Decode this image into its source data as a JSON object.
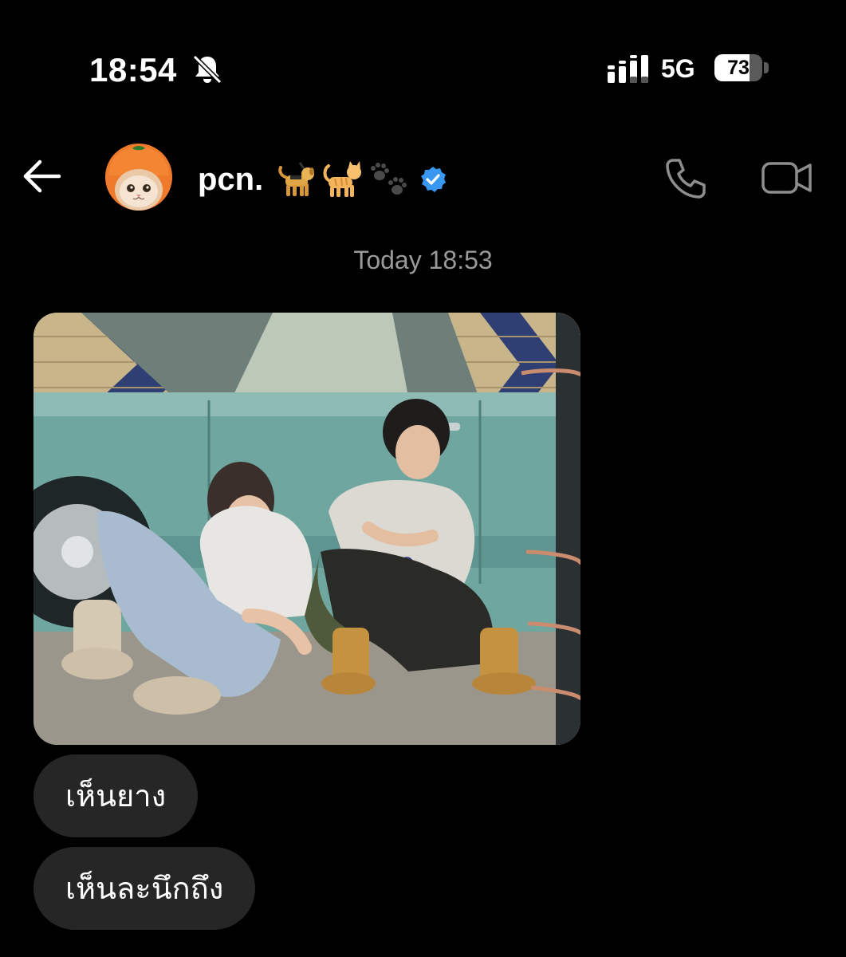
{
  "status_bar": {
    "time": "18:54",
    "network": "5G",
    "battery_percent": "73",
    "battery_level": 0.73,
    "icons": [
      "bell-off-icon",
      "signal-icon",
      "battery-icon"
    ]
  },
  "header": {
    "contact_name": "pcn.",
    "emojis": [
      "guide-dog-emoji",
      "cat-emoji",
      "paw-prints-emoji"
    ],
    "verified": true,
    "icons": [
      "back-arrow-icon",
      "phone-icon",
      "video-camera-icon"
    ]
  },
  "messages": {
    "timestamp": "Today 18:53",
    "photo": {
      "type": "image",
      "description_icon": "photo-card-image"
    },
    "texts": [
      "เห็นยาง",
      "เห็นละนึกถึง"
    ]
  },
  "colors": {
    "background": "#000000",
    "bubble": "#262626",
    "timestamp": "#9a9a9a",
    "verified": "#3897f0",
    "header_icon": "#8e8e8e"
  }
}
